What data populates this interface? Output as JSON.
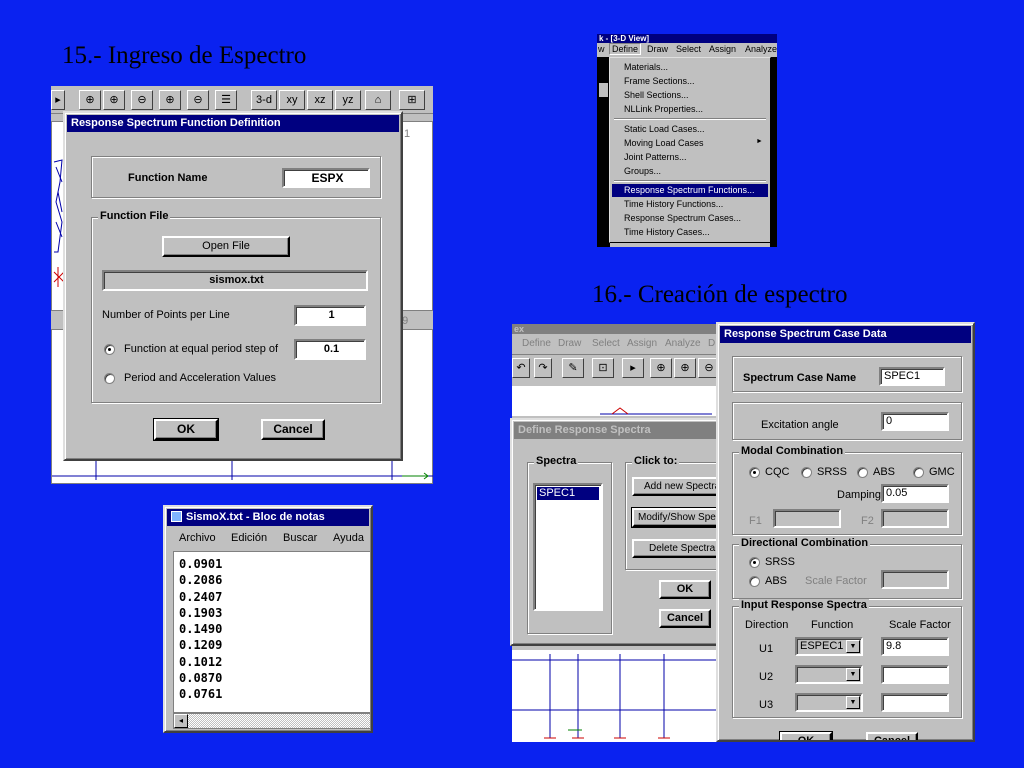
{
  "slide": {
    "title_15": "15.- Ingreso de Espectro",
    "title_16": "16.- Creación de espectro"
  },
  "cad_toolbar_15": {
    "btn_3d": "3-d",
    "btn_xy": "xy",
    "btn_xz": "xz",
    "btn_yz": "yz",
    "side_num_top": "1",
    "side_num_bottom": "39"
  },
  "rsfd": {
    "title": "Response Spectrum Function Definition",
    "function_name_label": "Function Name",
    "function_name_value": "ESPX",
    "function_file_group": "Function File",
    "open_file": "Open File",
    "file_name": "sismox.txt",
    "points_label": "Number of Points per Line",
    "points_value": "1",
    "radio_equal_period": "Function at equal period step of",
    "period_step_value": "0.1",
    "radio_period_accel": "Period and Acceleration Values",
    "ok": "OK",
    "cancel": "Cancel"
  },
  "notepad": {
    "title": "SismoX.txt - Bloc de notas",
    "menu": [
      "Archivo",
      "Edición",
      "Buscar",
      "Ayuda"
    ],
    "lines": [
      "0.0901",
      "0.2086",
      "0.2407",
      "0.1903",
      "0.1490",
      "0.1209",
      "0.1012",
      "0.0870",
      "0.0761"
    ]
  },
  "define_menu": {
    "title": "k - [3-D View]",
    "menubar": [
      "w",
      "Define",
      "Draw",
      "Select",
      "Assign",
      "Analyze"
    ],
    "items_a": [
      "Materials...",
      "Frame Sections...",
      "Shell Sections...",
      "NLLink Properties..."
    ],
    "items_b": [
      "Static Load Cases...",
      "Moving Load Cases",
      "Joint Patterns...",
      "Groups..."
    ],
    "items_c": [
      "Response Spectrum Functions...",
      "Time History Functions...",
      "Response Spectrum Cases...",
      "Time History Cases..."
    ],
    "submenu_arrow": "►"
  },
  "drs_window": {
    "title": "ex",
    "menubar": [
      "Define",
      "Draw",
      "Select",
      "Assign",
      "Analyze",
      "D"
    ]
  },
  "drs": {
    "title": "Define Response Spectra",
    "spectra_group": "Spectra",
    "spectra_items": [
      "SPEC1"
    ],
    "click_group": "Click to:",
    "add_new": "Add new Spectra",
    "modify_show": "Modify/Show Spectra",
    "delete": "Delete Spectra",
    "ok": "OK",
    "cancel": "Cancel"
  },
  "rscd": {
    "title": "Response Spectrum Case Data",
    "case_name_label": "Spectrum Case Name",
    "case_name_value": "SPEC1",
    "excitation_label": "Excitation  angle",
    "excitation_value": "0",
    "modal_group": "Modal Combination",
    "modal_options": [
      "CQC",
      "SRSS",
      "ABS",
      "GMC"
    ],
    "damping_label": "Damping",
    "damping_value": "0.05",
    "f1_label": "F1",
    "f2_label": "F2",
    "directional_group": "Directional Combination",
    "dir_srss": "SRSS",
    "dir_abs": "ABS",
    "scale_factor_label": "Scale Factor",
    "input_group": "Input Response Spectra",
    "col_direction": "Direction",
    "col_function": "Function",
    "col_scale": "Scale Factor",
    "u1": "U1",
    "u2": "U2",
    "u3": "U3",
    "u1_function": "ESPEC1",
    "u1_scale": "9.8",
    "ok": "OK",
    "cancel": "Cancel"
  }
}
